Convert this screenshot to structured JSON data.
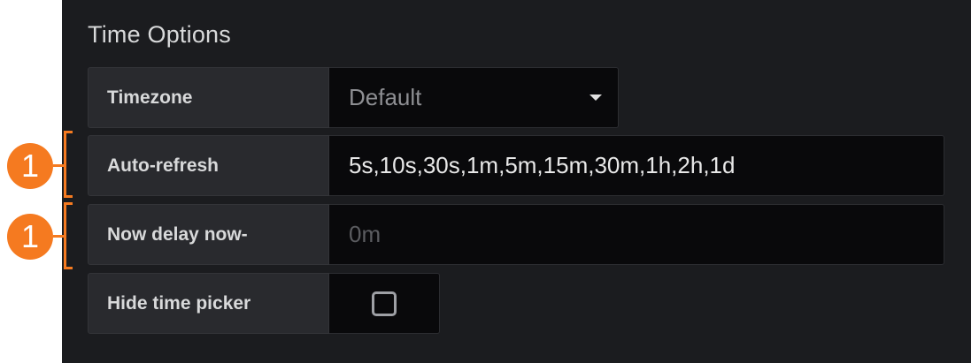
{
  "section": {
    "title": "Time Options"
  },
  "timezone": {
    "label": "Timezone",
    "value": "Default"
  },
  "auto_refresh": {
    "label": "Auto-refresh",
    "value": "5s,10s,30s,1m,5m,15m,30m,1h,2h,1d"
  },
  "now_delay": {
    "label": "Now delay now-",
    "placeholder": "0m"
  },
  "hide_time_picker": {
    "label": "Hide time picker",
    "checked": false
  },
  "callouts": [
    {
      "number": "1"
    },
    {
      "number": "1"
    }
  ],
  "colors": {
    "accent": "#f57a20",
    "panel": "#1b1c1f",
    "label_bg": "#292a2e",
    "input_bg": "#09090b"
  }
}
